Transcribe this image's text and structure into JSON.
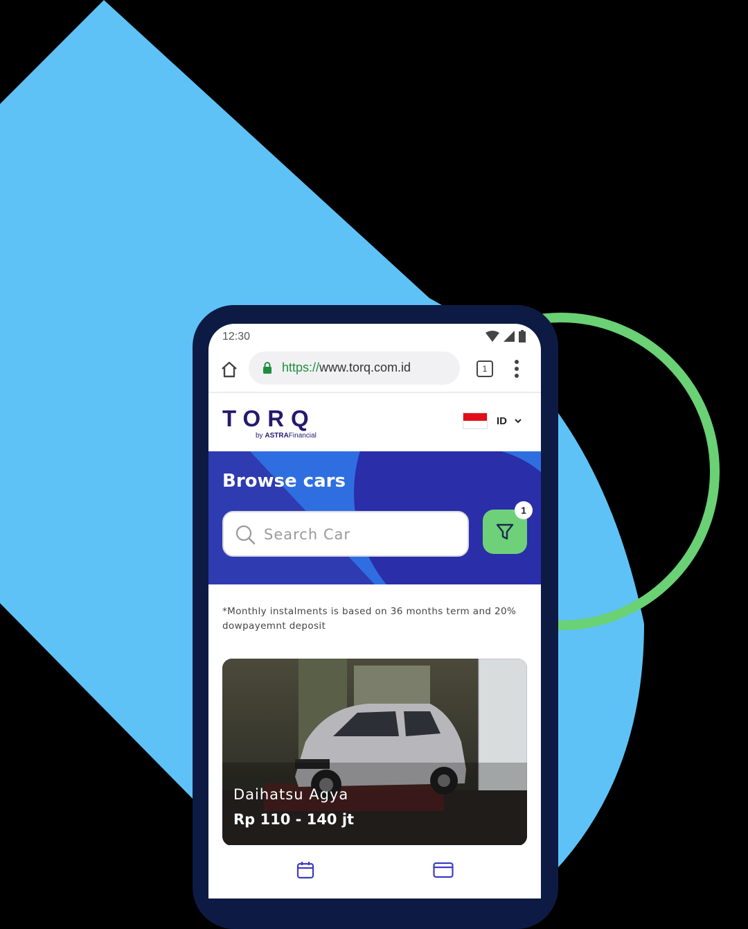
{
  "statusbar": {
    "time": "12:30"
  },
  "browser": {
    "url_scheme": "https://",
    "url_host": "www.torq.com.id",
    "tab_count": "1"
  },
  "site": {
    "logo": "TORQ",
    "logo_by": "by",
    "logo_brand": "ASTRA",
    "logo_brand_suffix": "Financial",
    "language_code": "ID"
  },
  "hero": {
    "title": "Browse cars",
    "search_placeholder": "Search Car",
    "filter_badge": "1"
  },
  "note": "*Monthly instalments is based on 36 months term and 20% dowpayemnt deposit",
  "cars": [
    {
      "name": "Daihatsu Agya",
      "price": "Rp 110 - 140 jt"
    }
  ],
  "colors": {
    "brand_navy": "#231a6f",
    "hero_blue": "#2f3bb0",
    "accent_green": "#6fd07a",
    "background_sky": "#5ec2f7"
  },
  "icons": {
    "home": "home-icon",
    "lock": "lock-icon",
    "tabs": "tabs-icon",
    "menu": "more-vert-icon",
    "search": "search-icon",
    "filter": "filter-icon",
    "calendar": "calendar-icon",
    "card": "credit-card-icon"
  }
}
